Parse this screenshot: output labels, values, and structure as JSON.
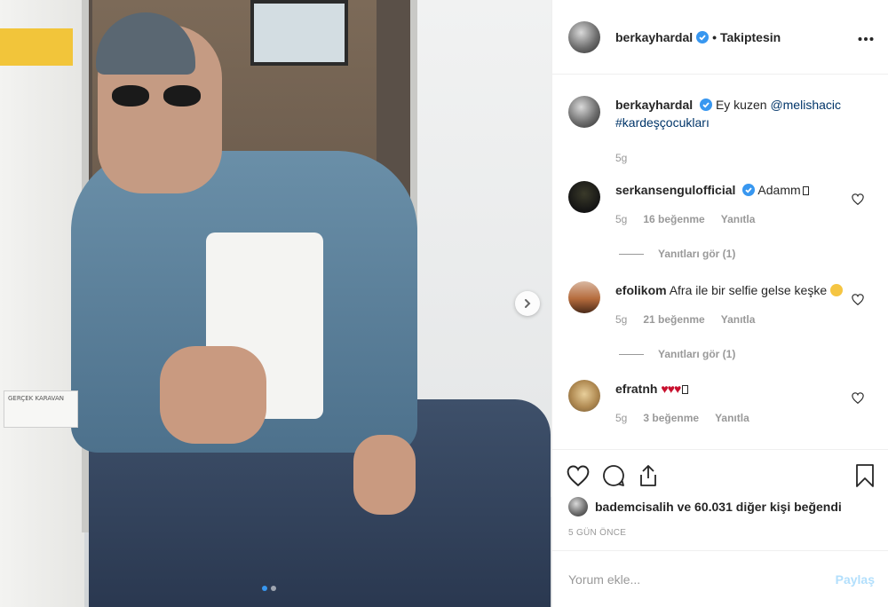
{
  "post": {
    "author": "berkayhardal",
    "follow_status": "• Takiptesin",
    "more_icon": "more-horizontal-icon",
    "photo": {
      "plate_text": "GERÇEK KARAVAN"
    }
  },
  "caption": {
    "username": "berkayhardal",
    "text": "Ey kuzen ",
    "mention": "@melishacic",
    "hashtag": "#kardeşçocukları",
    "time": "5g"
  },
  "comments": [
    {
      "username": "serkansengulofficial",
      "text": "Adamm",
      "time": "5g",
      "likes": "16 beğenme",
      "reply": "Yanıtla",
      "view_replies": "Yanıtları gör (1)"
    },
    {
      "username": "efolikom",
      "text": "Afra ile bir selfie gelse keşke",
      "time": "5g",
      "likes": "21 beğenme",
      "reply": "Yanıtla",
      "view_replies": "Yanıtları gör (1)"
    },
    {
      "username": "efratnh",
      "text": "♥♥♥",
      "time": "5g",
      "likes": "3 beğenme",
      "reply": "Yanıtla"
    }
  ],
  "likes": {
    "user": "bademcisalih",
    "rest": " ve 60.031 diğer kişi beğendi"
  },
  "date": "5 GÜN ÖNCE",
  "add_comment": {
    "placeholder": "Yorum ekle...",
    "post_label": "Paylaş"
  },
  "colors": {
    "verified": "#3897f0",
    "mention": "#003569",
    "post_disabled": "#b2dffc",
    "meta": "#999999"
  }
}
